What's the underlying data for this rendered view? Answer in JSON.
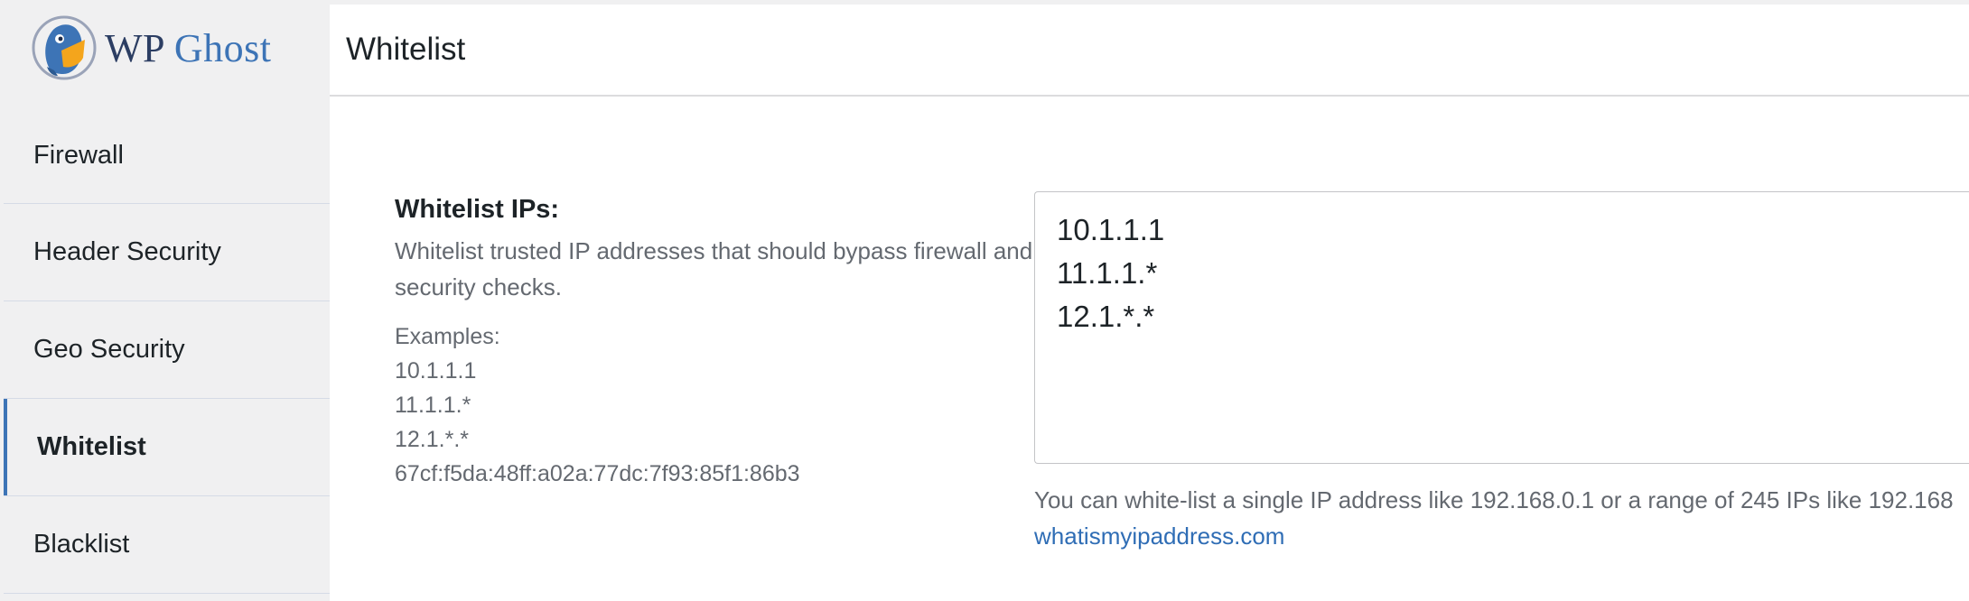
{
  "brand": {
    "wp": "WP",
    "ghost": "Ghost",
    "accent": "#3d74b6"
  },
  "sidebar": {
    "items": [
      {
        "label": "Firewall",
        "active": false
      },
      {
        "label": "Header Security",
        "active": false
      },
      {
        "label": "Geo Security",
        "active": false
      },
      {
        "label": "Whitelist",
        "active": true
      },
      {
        "label": "Blacklist",
        "active": false
      }
    ]
  },
  "header": {
    "title": "Whitelist"
  },
  "whitelist": {
    "label": "Whitelist IPs:",
    "description": "Whitelist trusted IP addresses that should bypass firewall and security checks.",
    "examples_title": "Examples:",
    "examples": [
      "10.1.1.1",
      "11.1.1.*",
      "12.1.*.*",
      "67cf:f5da:48ff:a02a:77dc:7f93:85f1:86b3"
    ],
    "textarea_lines": [
      "10.1.1.1",
      "11.1.1.*",
      "12.1.*.*"
    ],
    "help_text": "You can white-list a single IP address like 192.168.0.1 or a range of 245 IPs like 192.168",
    "help_link": "whatismyipaddress.com"
  }
}
